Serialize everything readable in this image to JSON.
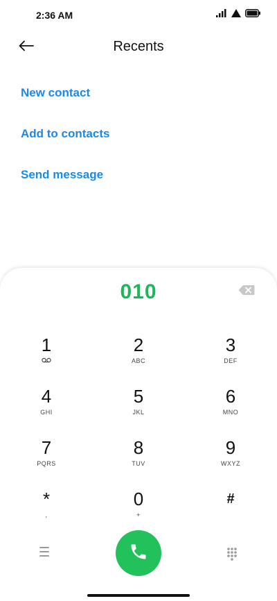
{
  "status_bar": {
    "time": "2:36 AM",
    "icons": [
      "signal-icon",
      "wifi-icon",
      "battery-icon"
    ]
  },
  "header": {
    "title": "Recents",
    "back_icon": "arrow-left-icon"
  },
  "actions": {
    "new_contact": "New contact",
    "add_to_contacts": "Add to contacts",
    "send_message": "Send message"
  },
  "dialer": {
    "number": "010",
    "backspace_icon": "backspace-icon",
    "keys": [
      {
        "digit": "1",
        "letters": "",
        "icon": "voicemail-icon"
      },
      {
        "digit": "2",
        "letters": "ABC"
      },
      {
        "digit": "3",
        "letters": "DEF"
      },
      {
        "digit": "4",
        "letters": "GHI"
      },
      {
        "digit": "5",
        "letters": "JKL"
      },
      {
        "digit": "6",
        "letters": "MNO"
      },
      {
        "digit": "7",
        "letters": "PQRS"
      },
      {
        "digit": "8",
        "letters": "TUV"
      },
      {
        "digit": "9",
        "letters": "WXYZ"
      },
      {
        "digit": "*",
        "letters": ","
      },
      {
        "digit": "0",
        "letters": "+"
      },
      {
        "digit": "#",
        "letters": ""
      }
    ],
    "menu_icon": "menu-icon",
    "call_icon": "phone-icon",
    "keypad_icon": "dialpad-icon"
  },
  "colors": {
    "accent_blue": "#1e88e5",
    "number_green": "#1fb55a",
    "call_green": "#22c15c"
  }
}
